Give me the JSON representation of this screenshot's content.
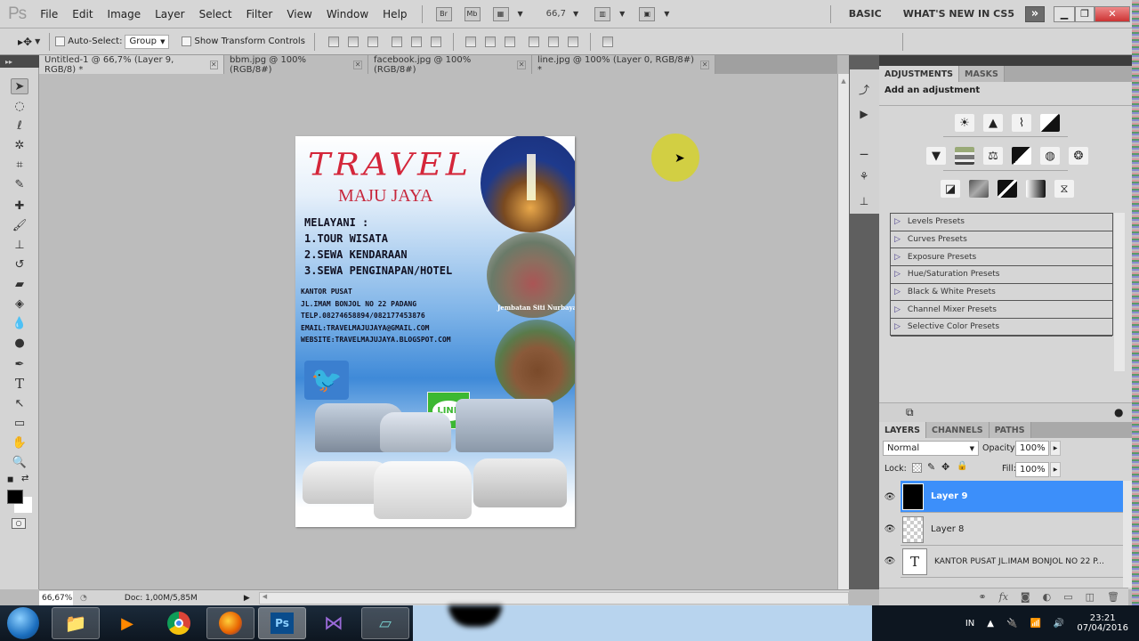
{
  "app": {
    "logo": "Ps",
    "menu": [
      "File",
      "Edit",
      "Image",
      "Layer",
      "Select",
      "Filter",
      "View",
      "Window",
      "Help"
    ],
    "app_bar": {
      "bridge": "Br",
      "mini_bridge": "Mb",
      "zoom_value": "66,7"
    },
    "workspaces": [
      "BASIC",
      "WHAT'S NEW IN CS5"
    ],
    "expand_label": "»"
  },
  "options_bar": {
    "auto_select_label": "Auto-Select:",
    "auto_select_checked": false,
    "auto_select_value": "Group",
    "show_transform_label": "Show Transform Controls",
    "show_transform_checked": false
  },
  "tabs": [
    {
      "label": "Untitled-1 @ 66,7% (Layer 9, RGB/8) *",
      "active": true
    },
    {
      "label": "bbm.jpg @ 100% (RGB/8#)",
      "active": false
    },
    {
      "label": "facebook.jpg @ 100% (RGB/8#)",
      "active": false
    },
    {
      "label": "line.jpg @ 100% (Layer 0, RGB/8#) *",
      "active": false
    }
  ],
  "tools": [
    "move-tool",
    "marquee-tool",
    "lasso-tool",
    "quick-select-tool",
    "crop-tool",
    "eyedropper-tool",
    "healing-brush-tool",
    "brush-tool",
    "clone-stamp-tool",
    "history-brush-tool",
    "eraser-tool",
    "paint-bucket-tool",
    "blur-tool",
    "dodge-tool",
    "pen-tool",
    "type-tool",
    "path-select-tool",
    "shape-tool",
    "hand-tool",
    "zoom-tool"
  ],
  "colors": {
    "foreground": "#000000",
    "background": "#ffffff",
    "selection": "#3c8ffa",
    "poster_red": "#d4263a"
  },
  "document": {
    "title": "TRAVEL",
    "subtitle": "MAJU JAYA",
    "services_heading": "MELAYANI :",
    "services": [
      "1.TOUR WISATA",
      "2.SEWA KENDARAAN",
      "3.SEWA PENGINAPAN/HOTEL"
    ],
    "contact": [
      "KANTOR PUSAT",
      "JL.IMAM BONJOL NO 22 PADANG",
      "TELP.08274658894/082177453876",
      "EMAIL:TRAVELMAJUJAYA@GMAIL.COM",
      "WEBSITE:TRAVELMAJUJAYA.BLOGSPOT.COM"
    ],
    "photo_caption": "Jembatan Siti Nurbaya",
    "line_logo": "LINE"
  },
  "status": {
    "zoom": "66,67%",
    "doc_info": "Doc: 1,00M/5,85M"
  },
  "adjustments": {
    "tabs": [
      "ADJUSTMENTS",
      "MASKS"
    ],
    "heading": "Add an adjustment",
    "presets": [
      "Levels Presets",
      "Curves Presets",
      "Exposure Presets",
      "Hue/Saturation Presets",
      "Black & White Presets",
      "Channel Mixer Presets",
      "Selective Color Presets"
    ]
  },
  "layers": {
    "tabs": [
      "LAYERS",
      "CHANNELS",
      "PATHS"
    ],
    "blend_mode": "Normal",
    "opacity_label": "Opacity:",
    "opacity": "100%",
    "lock_label": "Lock:",
    "fill_label": "Fill:",
    "fill": "100%",
    "items": [
      {
        "name": "Layer 9",
        "selected": true,
        "thumb": "black"
      },
      {
        "name": "Layer 8",
        "selected": false,
        "thumb": "transparent"
      },
      {
        "name": "KANTOR PUSAT JL.IMAM BONJOL NO 22 P...",
        "selected": false,
        "thumb": "text",
        "thumb_glyph": "T"
      }
    ]
  },
  "taskbar": {
    "apps": [
      "start",
      "explorer",
      "media-player",
      "chrome",
      "firefox",
      "photoshop",
      "visual-studio",
      "notepad"
    ],
    "tray_lang": "IN",
    "time": "23:21",
    "date": "07/04/2016"
  }
}
